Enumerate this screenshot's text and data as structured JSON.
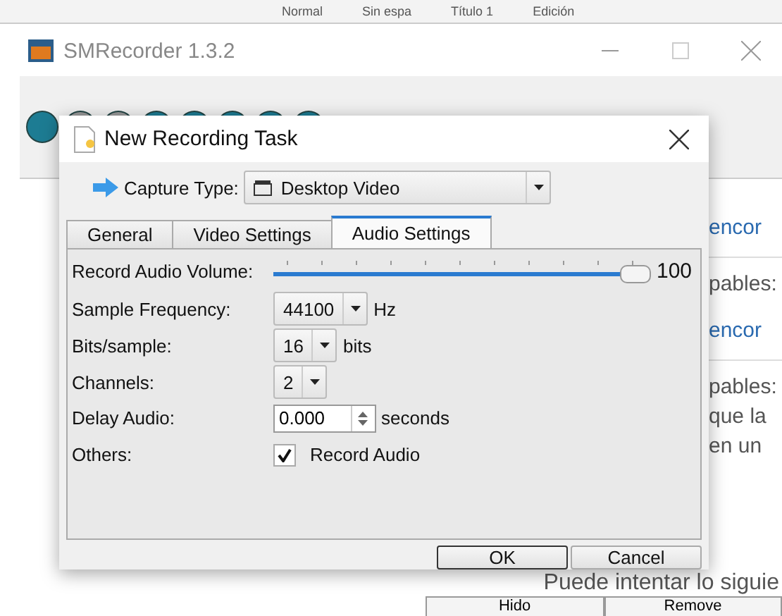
{
  "word_ribbon": {
    "items": [
      "Normal",
      "Sin espa",
      "Título 1",
      "Edición"
    ]
  },
  "main_window": {
    "title": "SMRecorder 1.3.2",
    "content": [
      {
        "kind": "heading",
        "text": "encor"
      },
      {
        "kind": "text",
        "text": "pables:"
      },
      {
        "kind": "heading",
        "text": "encor"
      },
      {
        "kind": "text",
        "text": "pables:"
      },
      {
        "kind": "text",
        "text": "que la"
      },
      {
        "kind": "text",
        "text": "en un"
      }
    ],
    "footer_text": "Puede intentar lo siguie",
    "buttons": [
      "Hido",
      "Remove"
    ]
  },
  "dialog": {
    "title": "New Recording Task",
    "capture_label": "Capture Type:",
    "capture_value": "Desktop Video",
    "tabs": [
      {
        "label": "General",
        "selected": false
      },
      {
        "label": "Video Settings",
        "selected": false
      },
      {
        "label": "Audio Settings",
        "selected": true
      }
    ],
    "volume": {
      "label": "Record Audio Volume:",
      "level": 1,
      "reading": "100"
    },
    "rows": [
      {
        "kind": "select",
        "label": "Sample Frequency:",
        "value": "44100",
        "unit": "Hz"
      },
      {
        "kind": "select",
        "label": "Bits/sample:",
        "value": "16",
        "unit": "bits"
      },
      {
        "kind": "select",
        "label": "Channels:",
        "value": "2"
      },
      {
        "kind": "spin",
        "label": "Delay Audio:",
        "value": "0.000",
        "unit": "seconds"
      },
      {
        "kind": "checkbox",
        "label": "Others:",
        "text": "Record Audio",
        "checked": true
      }
    ],
    "buttons": [
      {
        "label": "OK",
        "default": true
      },
      {
        "label": "Cancel",
        "default": false
      }
    ]
  }
}
